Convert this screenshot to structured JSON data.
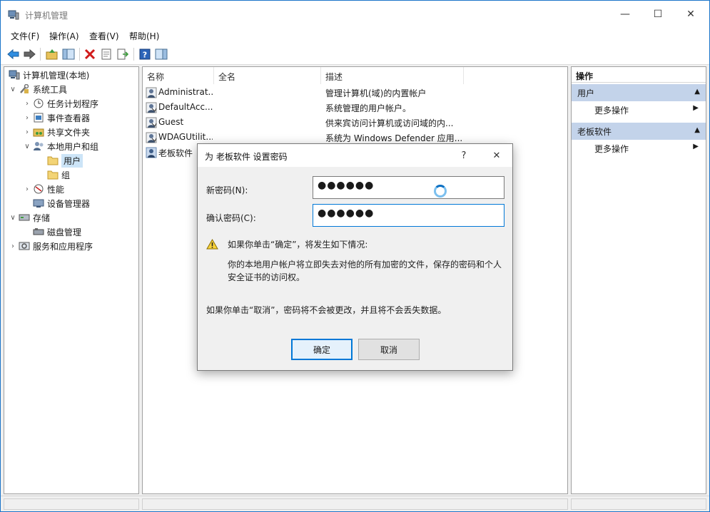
{
  "window": {
    "title": "计算机管理",
    "controls": {
      "minimize": "—",
      "maximize": "☐",
      "close": "✕"
    }
  },
  "menu": [
    "文件(F)",
    "操作(A)",
    "查看(V)",
    "帮助(H)"
  ],
  "toolbar_icons": [
    "back-arrow-icon",
    "forward-arrow-icon",
    "up-folder-icon",
    "show-hide-tree-icon",
    "delete-icon",
    "properties-icon",
    "export-list-icon",
    "help-icon",
    "show-hide-action-pane-icon"
  ],
  "tree": {
    "items": [
      {
        "label": "计算机管理(本地)",
        "icon": "computer-management-icon",
        "twisty": "",
        "depth": 0
      },
      {
        "label": "系统工具",
        "icon": "system-tools-icon",
        "twisty": "∨",
        "depth": 1
      },
      {
        "label": "任务计划程序",
        "icon": "clock-icon",
        "twisty": "›",
        "depth": 2
      },
      {
        "label": "事件查看器",
        "icon": "event-viewer-icon",
        "twisty": "›",
        "depth": 2
      },
      {
        "label": "共享文件夹",
        "icon": "shared-folder-icon",
        "twisty": "›",
        "depth": 2
      },
      {
        "label": "本地用户和组",
        "icon": "users-group-icon",
        "twisty": "∨",
        "depth": 2
      },
      {
        "label": "用户",
        "icon": "folder-icon",
        "twisty": "",
        "depth": 3,
        "selected": true
      },
      {
        "label": "组",
        "icon": "folder-icon",
        "twisty": "",
        "depth": 3
      },
      {
        "label": "性能",
        "icon": "performance-icon",
        "twisty": "›",
        "depth": 2
      },
      {
        "label": "设备管理器",
        "icon": "device-manager-icon",
        "twisty": "",
        "depth": 2
      },
      {
        "label": "存储",
        "icon": "storage-icon",
        "twisty": "∨",
        "depth": 1
      },
      {
        "label": "磁盘管理",
        "icon": "disk-icon",
        "twisty": "",
        "depth": 2
      },
      {
        "label": "服务和应用程序",
        "icon": "services-icon",
        "twisty": "›",
        "depth": 1
      }
    ]
  },
  "list": {
    "columns": [
      "名称",
      "全名",
      "描述"
    ],
    "rows": [
      {
        "name": "Administrat...",
        "fullname": "",
        "desc": "管理计算机(域)的内置帐户"
      },
      {
        "name": "DefaultAcc...",
        "fullname": "",
        "desc": "系统管理的用户帐户。"
      },
      {
        "name": "Guest",
        "fullname": "",
        "desc": "供来宾访问计算机或访问域的内..."
      },
      {
        "name": "WDAGUtilit...",
        "fullname": "",
        "desc": "系统为 Windows Defender 应用..."
      },
      {
        "name": "老板软件",
        "fullname": "",
        "desc": ""
      }
    ]
  },
  "actions": {
    "header": "操作",
    "sections": [
      {
        "title": "用户",
        "item": "更多操作"
      },
      {
        "title": "老板软件",
        "item": "更多操作"
      }
    ]
  },
  "dialog": {
    "title": "为 老板软件 设置密码",
    "help": "?",
    "close": "✕",
    "new_password_label": "新密码(N):",
    "new_password_value": "●●●●●●",
    "confirm_password_label": "确认密码(C):",
    "confirm_password_value": "●●●●●●",
    "warning_heading": "如果你单击“确定”，将发生如下情况:",
    "warning_body": "你的本地用户帐户将立即失去对他的所有加密的文件，保存的密码和个人安全证书的访问权。",
    "cancel_note": "如果你单击“取消”，密码将不会被更改，并且将不会丢失数据。",
    "ok_label": "确定",
    "cancel_label": "取消"
  },
  "colors": {
    "accent": "#0078d7",
    "action_section_bg": "#c3d3ea",
    "selection_bg": "#cce4f7",
    "window_border": "#1b74c9"
  }
}
